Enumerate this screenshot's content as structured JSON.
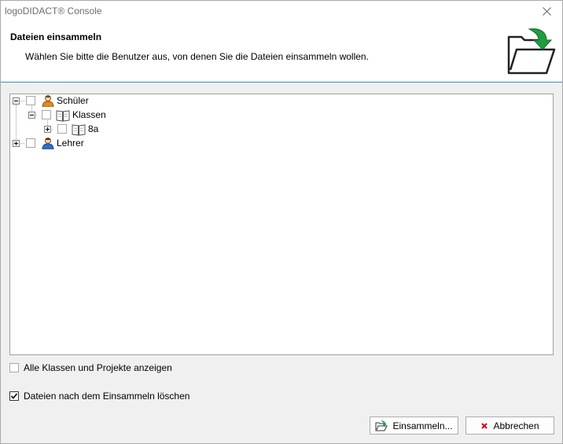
{
  "window": {
    "title": "logoDIDACT® Console"
  },
  "header": {
    "title": "Dateien einsammeln",
    "subtitle": "Wählen Sie bitte die Benutzer aus, von denen Sie die Dateien einsammeln wollen.",
    "icon": "folder-collect-icon"
  },
  "tree": {
    "nodes": [
      {
        "label": "Schüler",
        "icon": "student-icon",
        "expanded": true,
        "checked": false
      },
      {
        "label": "Klassen",
        "icon": "book-icon",
        "expanded": true,
        "checked": false
      },
      {
        "label": "8a",
        "icon": "book-icon",
        "expanded": false,
        "checked": false
      },
      {
        "label": "Lehrer",
        "icon": "teacher-icon",
        "expanded": false,
        "checked": false
      }
    ]
  },
  "options": {
    "show_all": {
      "label": "Alle Klassen und Projekte anzeigen",
      "checked": false
    },
    "delete_after": {
      "label": "Dateien nach dem Einsammeln löschen",
      "checked": true
    }
  },
  "buttons": {
    "collect": {
      "label": "Einsammeln...",
      "icon": "collect-icon"
    },
    "cancel": {
      "label": "Abbrechen",
      "icon": "cancel-x-icon"
    }
  },
  "colors": {
    "accent_line": "#3c8cd0",
    "cancel_x": "#d0021b",
    "arrow_green": "#1e9e3e"
  }
}
